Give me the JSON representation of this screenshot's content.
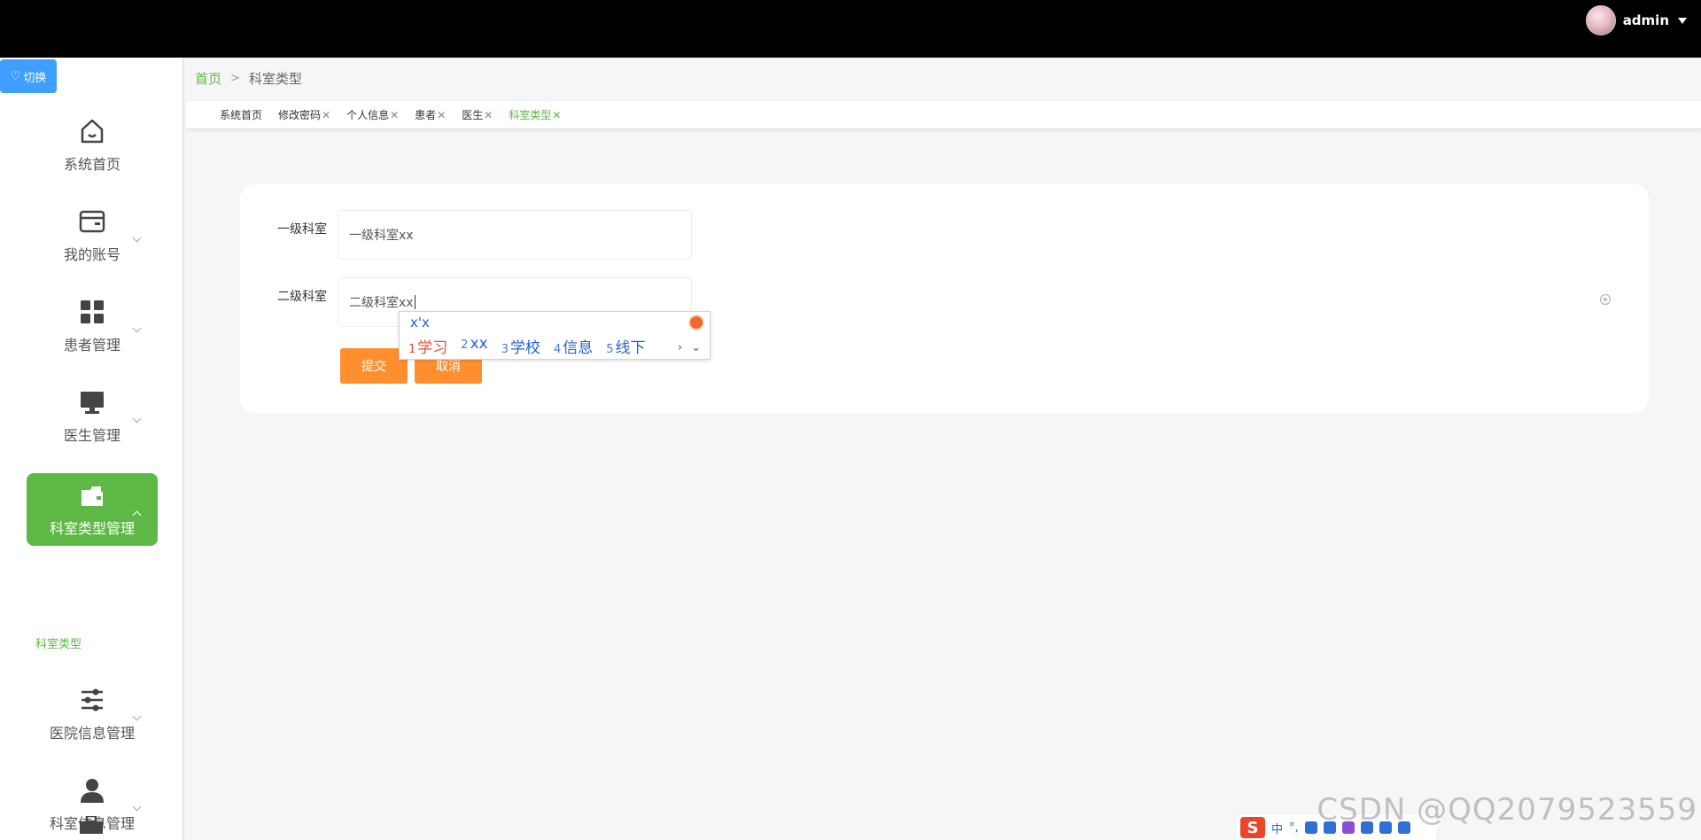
{
  "topbar": {
    "username": "admin"
  },
  "switch_button": {
    "label": "切换"
  },
  "sidebar": {
    "items": [
      {
        "label": "系统首页",
        "icon": "home-icon"
      },
      {
        "label": "我的账号",
        "icon": "wallet-icon"
      },
      {
        "label": "患者管理",
        "icon": "grid-icon"
      },
      {
        "label": "医生管理",
        "icon": "monitor-icon"
      },
      {
        "label": "科室类型管理",
        "icon": "folder-icon",
        "active": true
      },
      {
        "label": "医院信息管理",
        "icon": "sliders-icon"
      },
      {
        "label": "科室信息管理",
        "icon": "user-icon"
      }
    ],
    "submenu": {
      "label": "科室类型"
    }
  },
  "breadcrumb": {
    "home": "首页",
    "separator": ">",
    "current": "科室类型"
  },
  "tabs": [
    {
      "label": "系统首页",
      "closable": false
    },
    {
      "label": "修改密码",
      "closable": true
    },
    {
      "label": "个人信息",
      "closable": true
    },
    {
      "label": "患者",
      "closable": true
    },
    {
      "label": "医生",
      "closable": true
    },
    {
      "label": "科室类型",
      "closable": true,
      "active": true
    }
  ],
  "form": {
    "level1": {
      "label": "一级科室",
      "value": "一级科室xx"
    },
    "level2": {
      "label": "二级科室",
      "value": "二级科室xx"
    },
    "submit_label": "提交",
    "cancel_label": "取消"
  },
  "ime": {
    "composition": "x'x",
    "candidates": [
      {
        "n": "1",
        "text": "学习"
      },
      {
        "n": "2",
        "text": "xx"
      },
      {
        "n": "3",
        "text": "学校"
      },
      {
        "n": "4",
        "text": "信息"
      },
      {
        "n": "5",
        "text": "线下"
      }
    ],
    "toolbar_lang": "中",
    "toolbar_punct": "°,"
  },
  "watermark": "CSDN @QQ2079523559",
  "colors": {
    "accent": "#5eb846",
    "button": "#ff8f2e",
    "switch": "#409eff",
    "topbar": "#000000"
  }
}
